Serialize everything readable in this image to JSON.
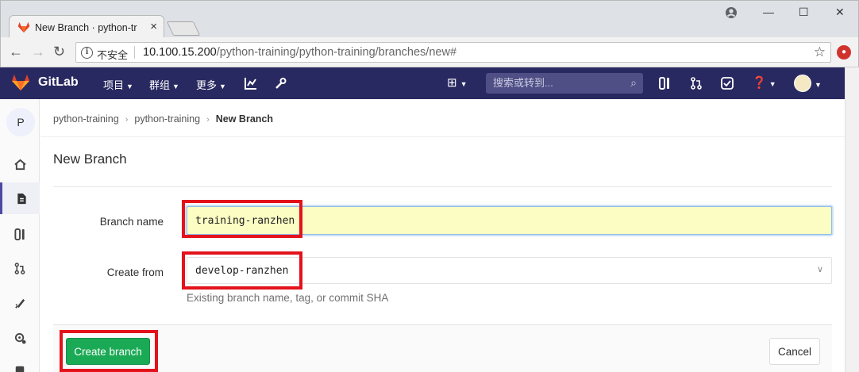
{
  "browser": {
    "tab_title": "New Branch · python-tr",
    "tab_close": "×",
    "minimize": "—",
    "maximize": "☐",
    "close": "✕",
    "back": "←",
    "forward": "→",
    "reload": "↻",
    "security_label": "不安全",
    "url_host": "10.100.15.200",
    "url_path": "/python-training/python-training/branches/new#",
    "bookmark_icon": "☆"
  },
  "header": {
    "brand": "GitLab",
    "menu": [
      "项目",
      "群组",
      "更多"
    ],
    "search_placeholder": "搜索或转到...",
    "colors": {
      "header_bg": "#292961",
      "accent": "#1aaa55",
      "highlight": "#e3121b"
    }
  },
  "sidebar": {
    "project_initial": "P",
    "items": [
      "home-icon",
      "file-icon",
      "issues-icon",
      "merge-request-icon",
      "rocket-icon",
      "settings-icon"
    ]
  },
  "breadcrumb": {
    "items": [
      "python-training",
      "python-training"
    ],
    "current": "New Branch"
  },
  "page": {
    "title": "New Branch",
    "branch_name_label": "Branch name",
    "branch_name_value": "training-ranzhen",
    "create_from_label": "Create from",
    "create_from_value": "develop-ranzhen",
    "help_text": "Existing branch name, tag, or commit SHA",
    "create_button": "Create branch",
    "cancel_button": "Cancel"
  }
}
